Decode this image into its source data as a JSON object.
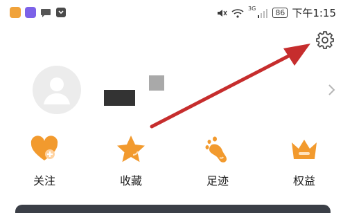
{
  "status_bar": {
    "battery": "86",
    "time": "下午1:15",
    "network": "3G"
  },
  "quick_actions": [
    {
      "label": "关注",
      "icon": "heart-plus-icon"
    },
    {
      "label": "收藏",
      "icon": "star-icon"
    },
    {
      "label": "足迹",
      "icon": "footprint-icon"
    },
    {
      "label": "权益",
      "icon": "crown-icon"
    }
  ],
  "icons": {
    "settings": "gear-icon",
    "chevron": "chevron-right-icon",
    "avatar": "default-avatar-icon"
  },
  "colors": {
    "accent_orange": "#f29a2e",
    "annotation_arrow": "#c62d2d",
    "text_primary": "#1f1f1f",
    "avatar_bg": "#ececec",
    "bottom_strip": "#3b3f47"
  }
}
